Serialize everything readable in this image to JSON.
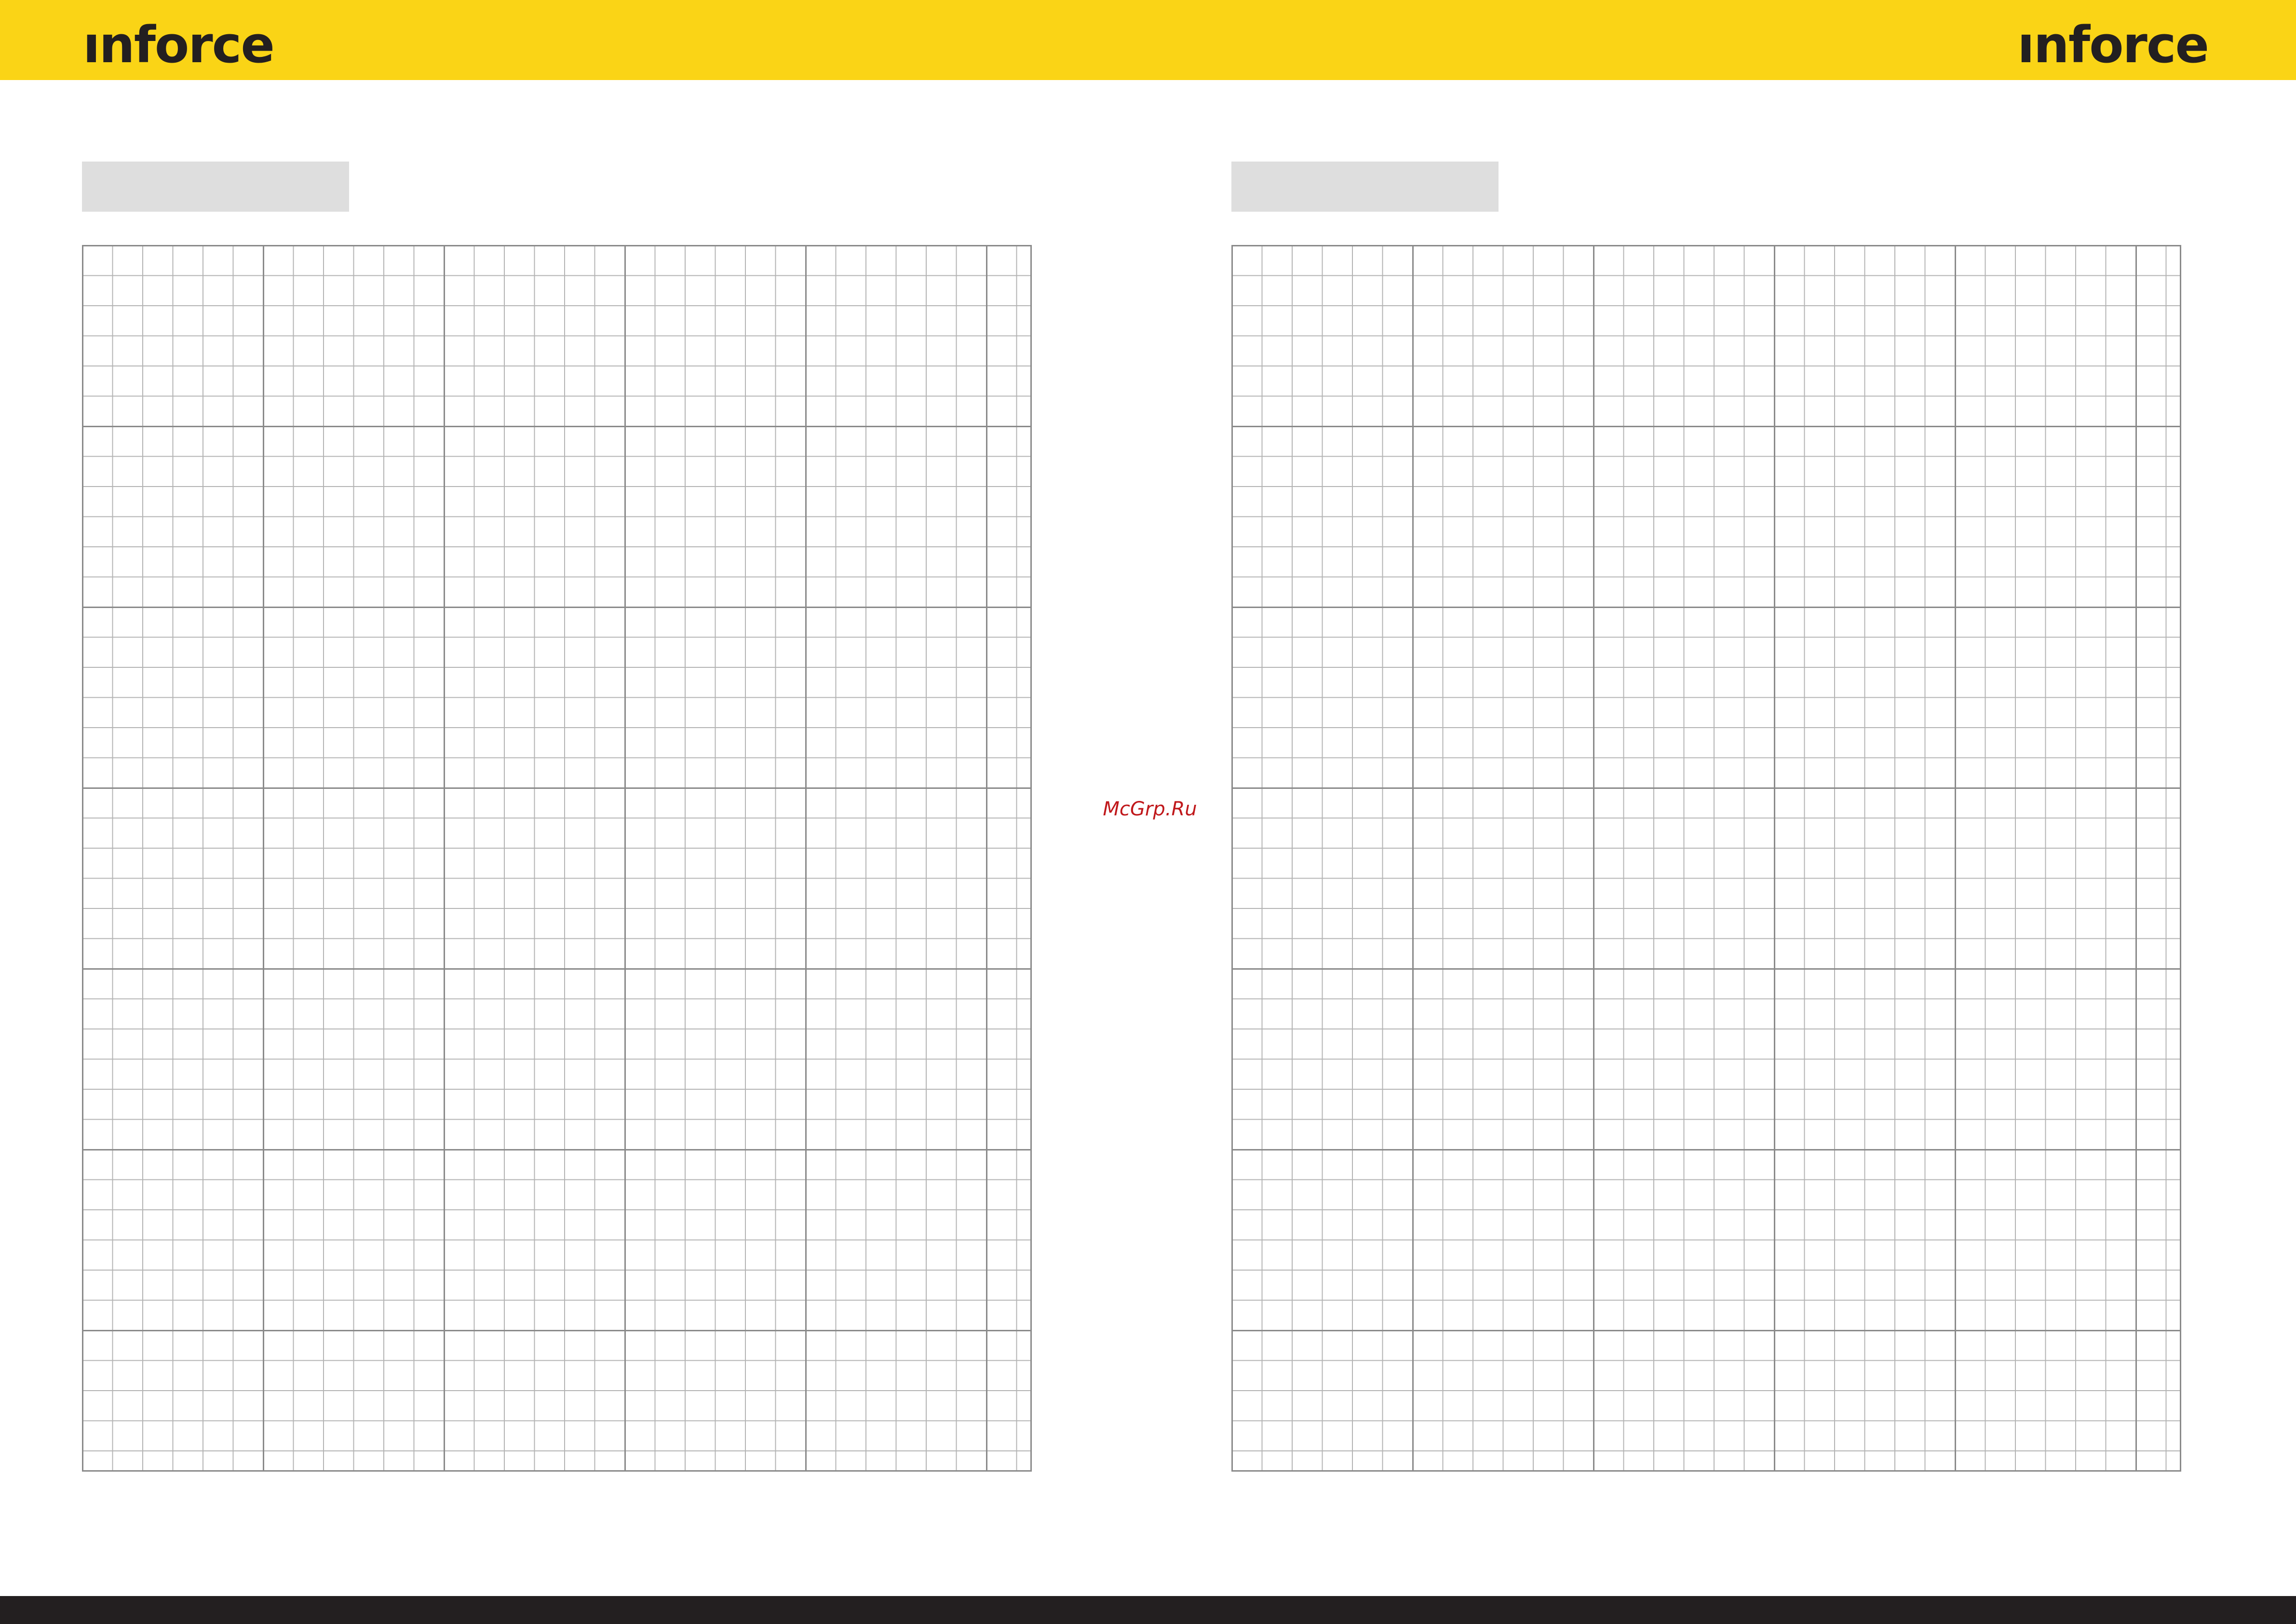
{
  "header": {
    "logo_left": "ınforce",
    "logo_right": "ınforce",
    "band_color": "#fad416",
    "logo_color": "#231f20"
  },
  "pages": [
    {
      "title": "",
      "title_box_color": "#dedede",
      "grid": {
        "columns": 32,
        "rows": 41,
        "major_every": 6
      }
    },
    {
      "title": "",
      "title_box_color": "#dedede",
      "grid": {
        "columns": 32,
        "rows": 41,
        "major_every": 6
      }
    }
  ],
  "watermark": {
    "text": "McGrp.Ru",
    "color": "#c0181b"
  },
  "footer": {
    "band_color": "#231f20"
  }
}
